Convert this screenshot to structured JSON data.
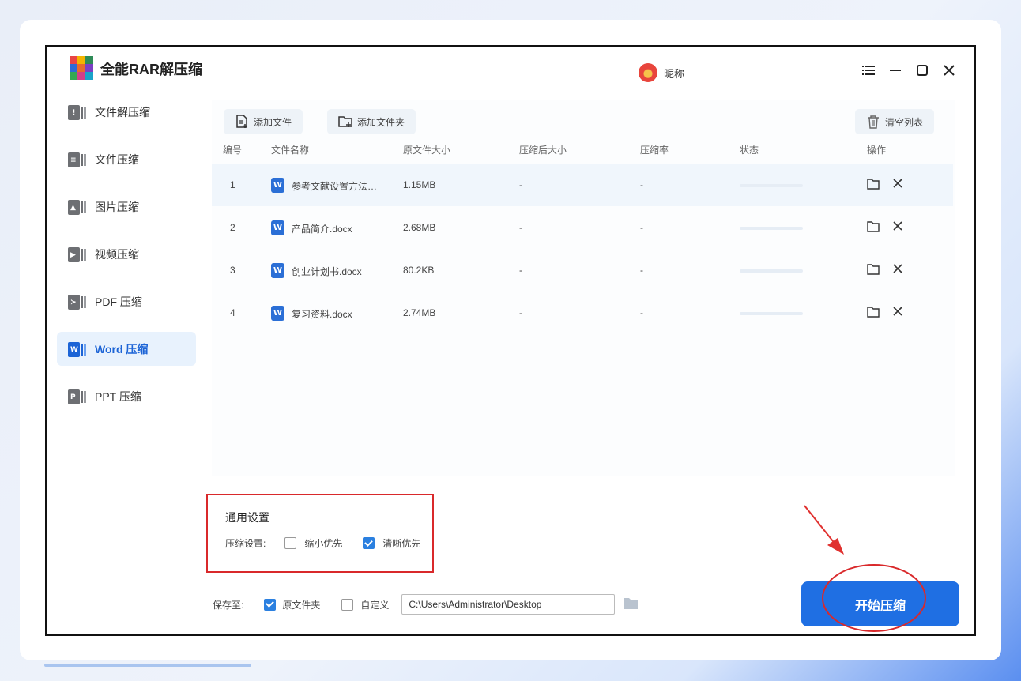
{
  "app": {
    "title": "全能RAR解压缩",
    "username": "昵称"
  },
  "window_controls": [
    "menu-icon",
    "minimize-icon",
    "maximize-icon",
    "close-icon"
  ],
  "sidebar": {
    "items": [
      {
        "label": "文件解压缩",
        "icon": "zip-icon"
      },
      {
        "label": "文件压缩",
        "icon": "compress-icon"
      },
      {
        "label": "图片压缩",
        "icon": "image-icon"
      },
      {
        "label": "视频压缩",
        "icon": "video-icon"
      },
      {
        "label": "PDF 压缩",
        "icon": "pdf-icon"
      },
      {
        "label": "Word 压缩",
        "icon": "word-icon",
        "active": true
      },
      {
        "label": "PPT 压缩",
        "icon": "ppt-icon"
      }
    ]
  },
  "toolbar": {
    "add_file": "添加文件",
    "add_folder": "添加文件夹",
    "clear_list": "清空列表"
  },
  "table": {
    "headers": [
      "编号",
      "文件名称",
      "原文件大小",
      "压缩后大小",
      "压缩率",
      "状态",
      "操作"
    ],
    "rows": [
      {
        "no": "1",
        "name": "参考文献设置方法…",
        "size": "1.15MB",
        "after": "-",
        "ratio": "-",
        "progress": 0
      },
      {
        "no": "2",
        "name": "产品简介.docx",
        "size": "2.68MB",
        "after": "-",
        "ratio": "-",
        "progress": 0
      },
      {
        "no": "3",
        "name": "创业计划书.docx",
        "size": "80.2KB",
        "after": "-",
        "ratio": "-",
        "progress": 0
      },
      {
        "no": "4",
        "name": "复习资料.docx",
        "size": "2.74MB",
        "after": "-",
        "ratio": "-",
        "progress": 0
      }
    ]
  },
  "settings": {
    "title": "通用设置",
    "compress_label": "压缩设置:",
    "option_small": {
      "label": "缩小优先",
      "checked": false
    },
    "option_clear": {
      "label": "清晰优先",
      "checked": true
    }
  },
  "save": {
    "label": "保存至:",
    "original_folder": {
      "label": "原文件夹",
      "checked": true
    },
    "custom": {
      "label": "自定义",
      "checked": false
    },
    "path": "C:\\Users\\Administrator\\Desktop"
  },
  "start_button": "开始压缩",
  "colors": {
    "accent": "#1f6fe3",
    "annotation": "#d9292b",
    "active_bg": "#e8f2fd"
  }
}
